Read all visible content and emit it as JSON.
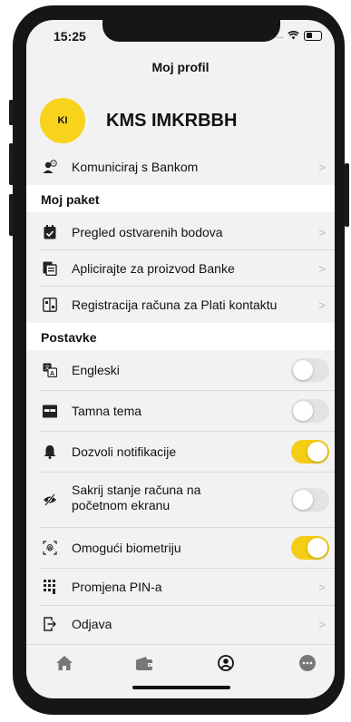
{
  "status_bar": {
    "time": "15:25"
  },
  "header": {
    "title": "Moj profil"
  },
  "profile": {
    "initials": "KI",
    "name": "KMS IMKRBBH"
  },
  "contact": {
    "label": "Komuniciraj s Bankom"
  },
  "sections": {
    "package": "Moj paket",
    "settings": "Postavke"
  },
  "package_items": [
    {
      "label": "Pregled ostvarenih bodova",
      "icon": "calendar-check-icon"
    },
    {
      "label": "Aplicirajte za proizvod Banke",
      "icon": "application-form-icon"
    },
    {
      "label": "Registracija računa za Plati kontaktu",
      "icon": "contact-registration-icon"
    }
  ],
  "settings_items": [
    {
      "label": "Engleski",
      "icon": "translate-icon",
      "enabled": false
    },
    {
      "label": "Tamna tema",
      "icon": "theme-icon",
      "enabled": false
    },
    {
      "label": "Dozvoli notifikacije",
      "icon": "bell-icon",
      "enabled": true
    },
    {
      "label_line1": "Sakrij stanje računa na",
      "label_line2": "početnom ekranu",
      "icon": "eye-off-icon",
      "enabled": false
    },
    {
      "label": "Omogući biometriju",
      "icon": "fingerprint-icon",
      "enabled": true
    }
  ],
  "other_items": [
    {
      "label": "Promjena PIN-a",
      "icon": "pin-keypad-icon"
    },
    {
      "label": "Odjava",
      "icon": "logout-icon"
    }
  ],
  "tabs": [
    "home-icon",
    "wallet-icon",
    "profile-icon",
    "more-icon"
  ],
  "colors": {
    "accent": "#f5cd16",
    "toggle_off": "#e3e3e3",
    "background": "#f2f2f2"
  }
}
